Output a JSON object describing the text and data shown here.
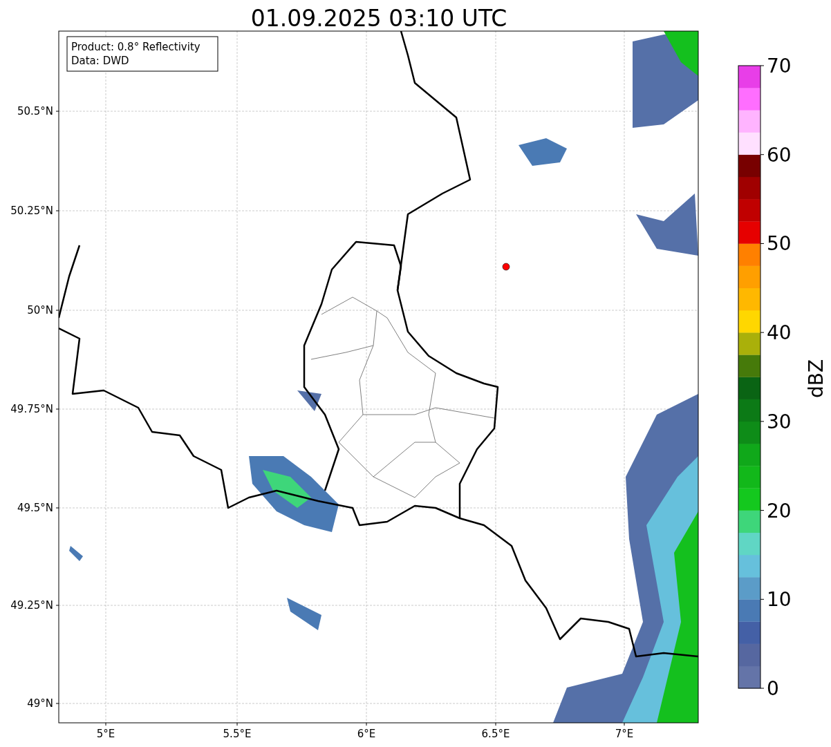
{
  "title": "01.09.2025 03:10 UTC",
  "info_box": [
    "Product: 0.8° Reflectivity",
    "Data: DWD"
  ],
  "x_ticks": [
    "5°E",
    "5.5°E",
    "6°E",
    "6.5°E",
    "7°E"
  ],
  "y_ticks": [
    "50.5°N",
    "50.25°N",
    "50°N",
    "49.75°N",
    "49.5°N",
    "49.25°N",
    "49°N"
  ],
  "colorbar": {
    "label": "dBZ",
    "ticks": [
      "70",
      "60",
      "50",
      "40",
      "30",
      "20",
      "10",
      "0"
    ],
    "bins": [
      {
        "color": "#6474a8"
      },
      {
        "color": "#5667a0"
      },
      {
        "color": "#4460a6"
      },
      {
        "color": "#4a7ab4"
      },
      {
        "color": "#5b9cc8"
      },
      {
        "color": "#66c0dc"
      },
      {
        "color": "#60d6c4"
      },
      {
        "color": "#3ed67a"
      },
      {
        "color": "#14c81e"
      },
      {
        "color": "#12b81a"
      },
      {
        "color": "#10a81a"
      },
      {
        "color": "#0e8c18"
      },
      {
        "color": "#0c7a16"
      },
      {
        "color": "#0a6414"
      },
      {
        "color": "#467a0a"
      },
      {
        "color": "#aab00a"
      },
      {
        "color": "#ffd700"
      },
      {
        "color": "#ffb800"
      },
      {
        "color": "#ff9f00"
      },
      {
        "color": "#ff8000"
      },
      {
        "color": "#e60000"
      },
      {
        "color": "#c00000"
      },
      {
        "color": "#a00000"
      },
      {
        "color": "#780000"
      },
      {
        "color": "#ffe0ff"
      },
      {
        "color": "#ffb4ff"
      },
      {
        "color": "#ff6eff"
      },
      {
        "color": "#e83ee8"
      }
    ]
  }
}
